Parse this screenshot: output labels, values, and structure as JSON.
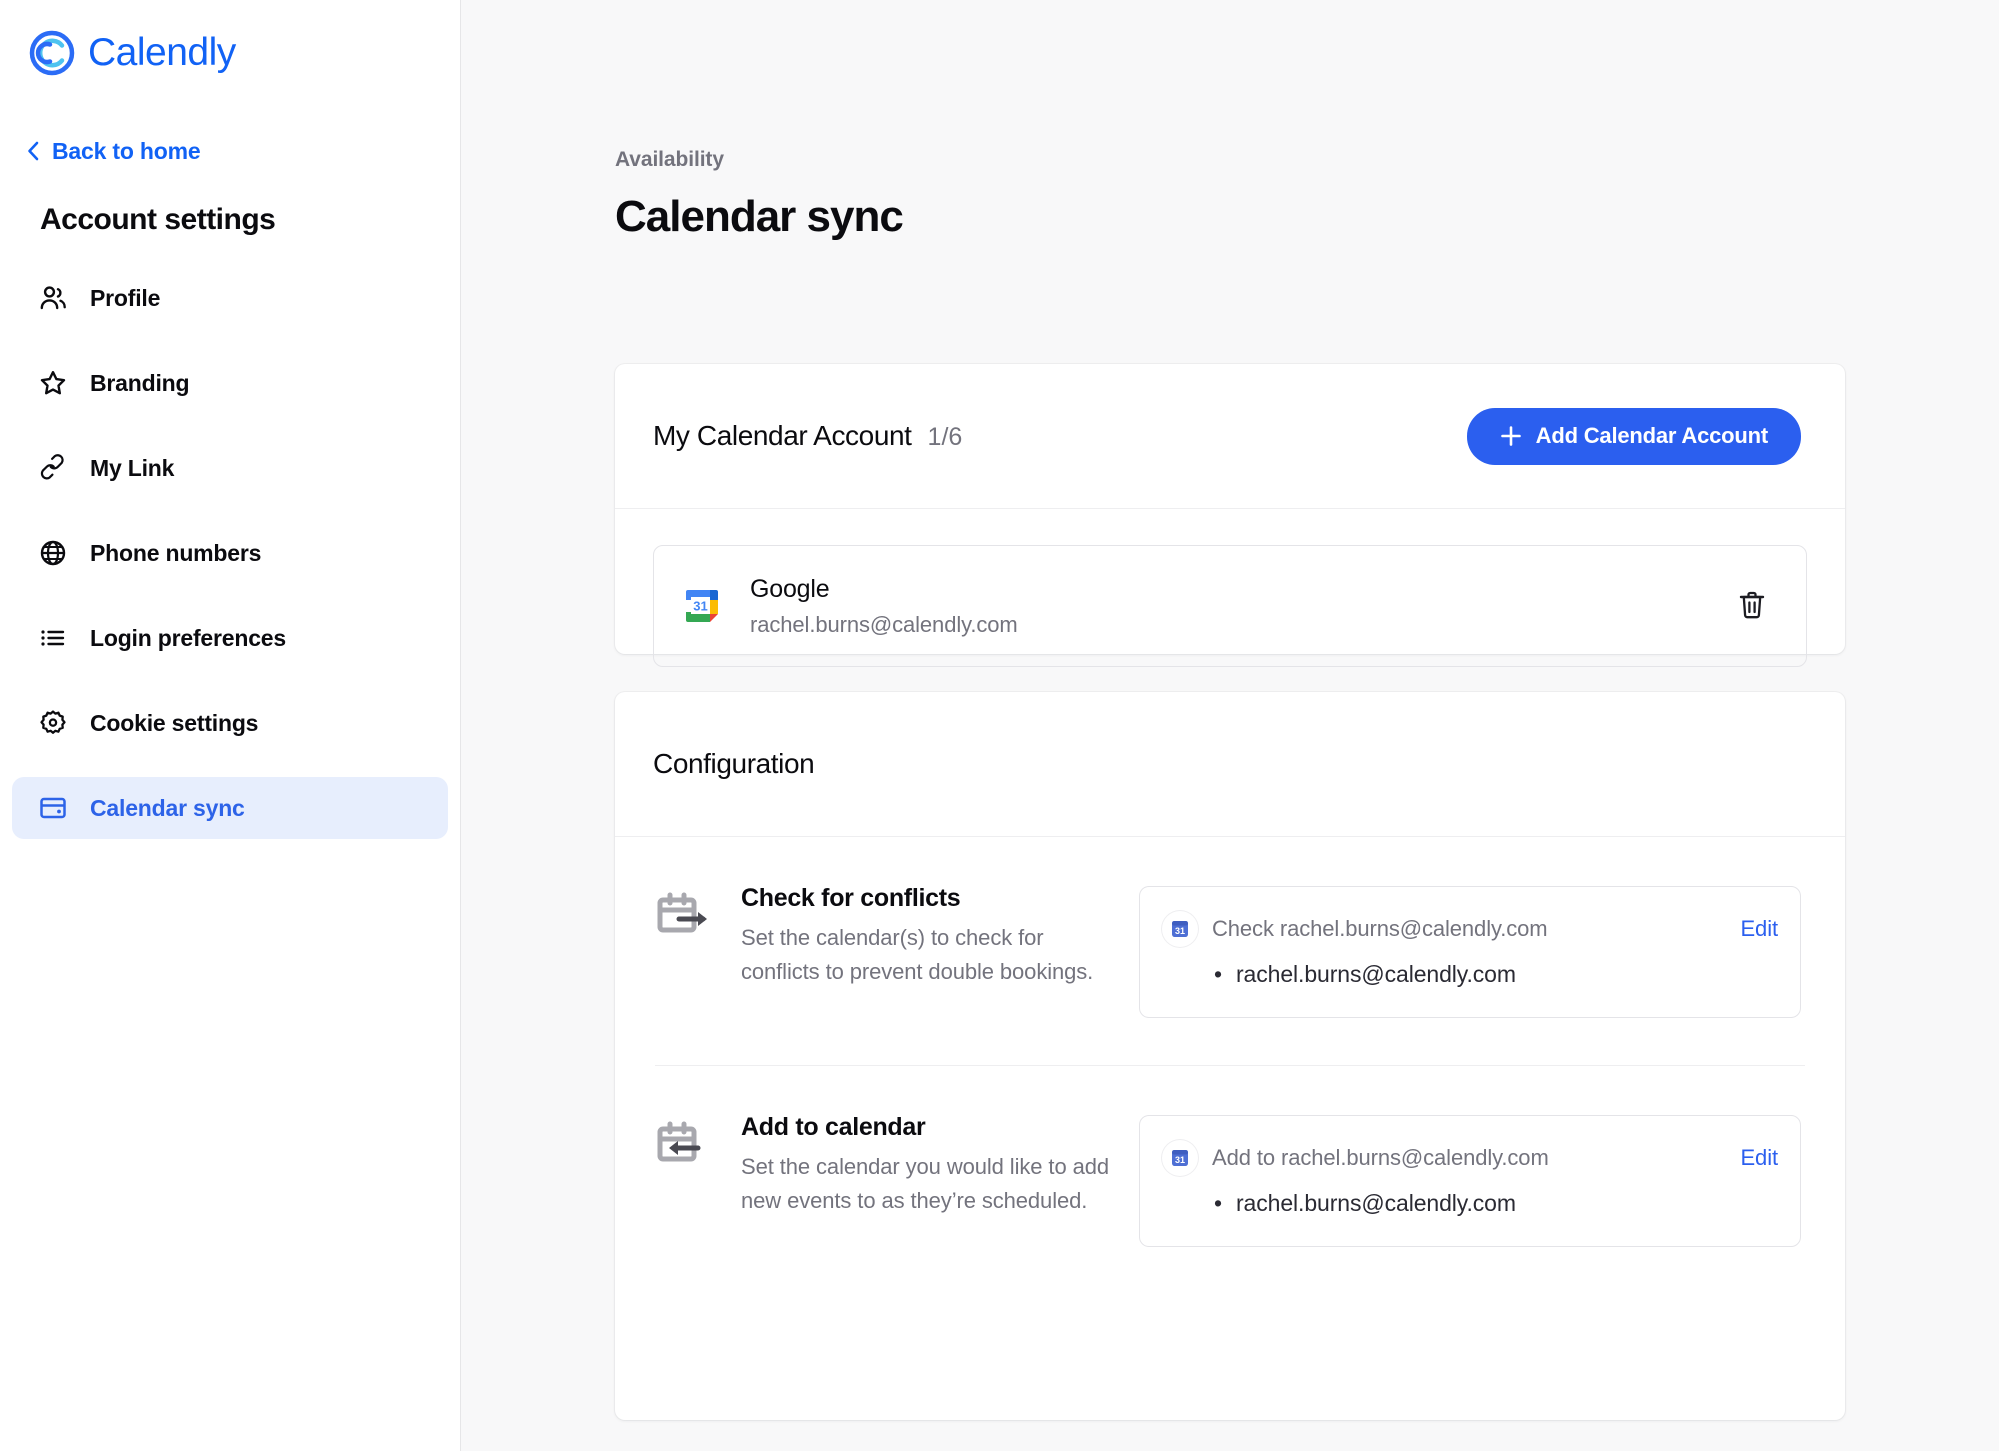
{
  "brand": {
    "name": "Calendly",
    "logo_icon": "calendly-logo-icon",
    "accent_color": "#1162f5",
    "primary_button_color": "#2b5fef",
    "active_nav_background": "#e7eefd"
  },
  "sidebar": {
    "back_link": {
      "label": "Back to home",
      "icon": "chevron-left-icon"
    },
    "title": "Account settings",
    "items": [
      {
        "label": "Profile",
        "icon": "users-icon",
        "active": false
      },
      {
        "label": "Branding",
        "icon": "star-icon",
        "active": false
      },
      {
        "label": "My Link",
        "icon": "link-icon",
        "active": false
      },
      {
        "label": "Phone numbers",
        "icon": "globe-icon",
        "active": false
      },
      {
        "label": "Login preferences",
        "icon": "list-icon",
        "active": false
      },
      {
        "label": "Cookie settings",
        "icon": "gear-icon",
        "active": false
      },
      {
        "label": "Calendar sync",
        "icon": "calendar-card-icon",
        "active": true
      }
    ]
  },
  "main": {
    "breadcrumb": "Availability",
    "page_title": "Calendar sync",
    "accounts_card": {
      "title": "My Calendar Account",
      "count": "1/6",
      "add_button": {
        "label": "Add Calendar Account",
        "icon": "plus-icon"
      },
      "rows": [
        {
          "provider": "Google",
          "email": "rachel.burns@calendly.com",
          "icon": "google-calendar-icon",
          "delete_icon": "trash-icon"
        }
      ]
    },
    "configuration_card": {
      "title": "Configuration",
      "rows": [
        {
          "icon": "calendar-arrow-out-icon",
          "title": "Check for conflicts",
          "description": "Set the calendar(s) to check for conflicts to prevent double bookings.",
          "panel": {
            "badge_icon": "google-calendar-badge-icon",
            "label": "Check rachel.burns@calendly.com",
            "edit_label": "Edit",
            "calendars": [
              "rachel.burns@calendly.com"
            ]
          }
        },
        {
          "icon": "calendar-arrow-in-icon",
          "title": "Add to calendar",
          "description": "Set the calendar you would like to add new events to as they’re scheduled.",
          "panel": {
            "badge_icon": "google-calendar-badge-icon",
            "label": "Add to rachel.burns@calendly.com",
            "edit_label": "Edit",
            "calendars": [
              "rachel.burns@calendly.com"
            ]
          }
        }
      ]
    }
  }
}
